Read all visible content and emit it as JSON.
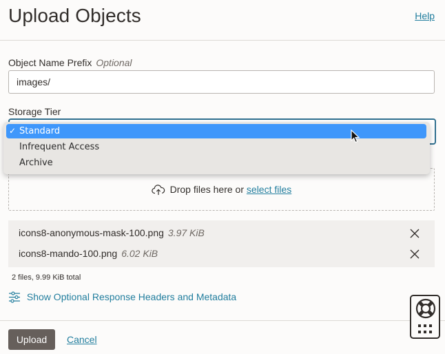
{
  "header": {
    "title": "Upload Objects",
    "help_label": "Help"
  },
  "prefix": {
    "label": "Object Name Prefix",
    "optional_label": "Optional",
    "value": "images/"
  },
  "storage_tier": {
    "label": "Storage Tier",
    "selected": "Standard",
    "options": [
      "Standard",
      "Infrequent Access",
      "Archive"
    ]
  },
  "dropzone": {
    "text": "Drop files here or",
    "link_text": "select files",
    "icon": "cloud-upload-icon"
  },
  "files": {
    "items": [
      {
        "name": "icons8-anonymous-mask-100.png",
        "size": "3.97 KiB"
      },
      {
        "name": "icons8-mando-100.png",
        "size": "6.02 KiB"
      }
    ],
    "total": "2 files, 9.99 KiB total"
  },
  "optional_headers": {
    "label": "Show Optional Response Headers and Metadata",
    "icon": "sliders-icon"
  },
  "footer": {
    "upload_label": "Upload",
    "cancel_label": "Cancel"
  },
  "colors": {
    "link": "#227e9e",
    "primary_button": "#665f5b",
    "selected_option": "#3f97fb",
    "focus_border": "#2f6f8f"
  }
}
